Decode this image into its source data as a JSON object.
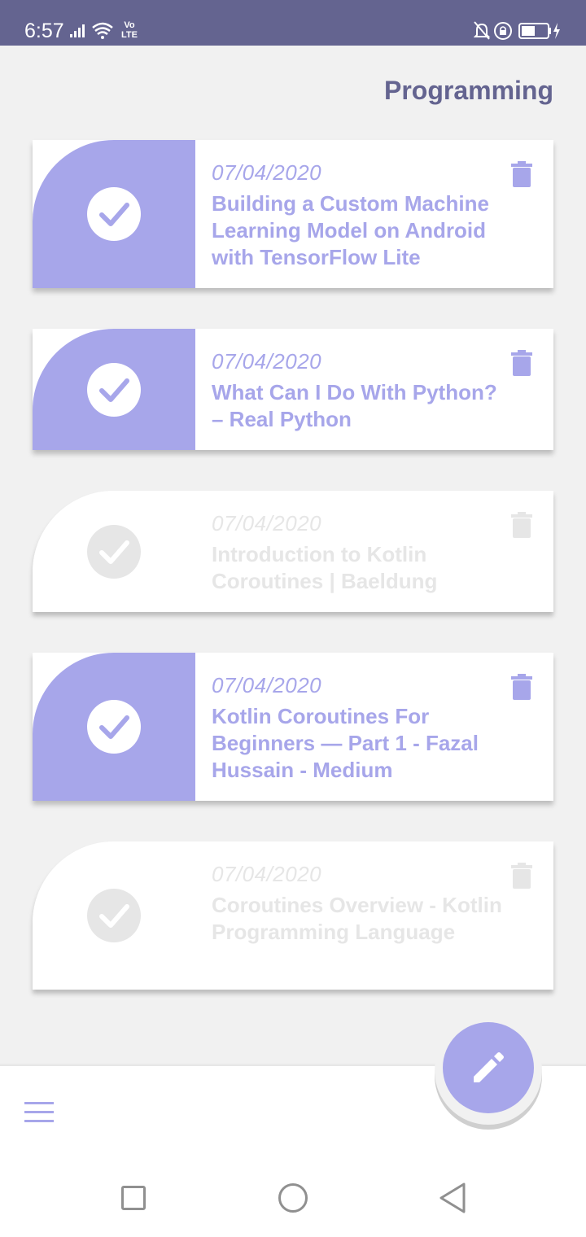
{
  "status_bar": {
    "time": "6:57",
    "volte": "Vo\nLTE",
    "icons": [
      "signal-icon",
      "wifi-icon",
      "volte-icon",
      "mute-bell-icon",
      "lock-rotation-icon",
      "battery-icon"
    ]
  },
  "header": {
    "title": "Programming"
  },
  "cards": [
    {
      "date": "07/04/2020",
      "title": "Building a Custom Machine Learning Model on Android with TensorFlow Lite",
      "done": true
    },
    {
      "date": "07/04/2020",
      "title": "What Can I Do With Python? – Real Python",
      "done": true
    },
    {
      "date": "07/04/2020",
      "title": "Introduction to Kotlin Coroutines | Baeldung",
      "done": false
    },
    {
      "date": "07/04/2020",
      "title": "Kotlin Coroutines For Beginners — Part 1 - Fazal Hussain - Medium",
      "done": true
    },
    {
      "date": "07/04/2020",
      "title": "Coroutines Overview - Kotlin Programming Language",
      "done": false
    }
  ],
  "bottom_bar": {
    "menu_icon": "hamburger-menu-icon",
    "fab_icon": "pencil-icon"
  },
  "nav_bar": {
    "icons": [
      "recents-icon",
      "home-icon",
      "back-icon"
    ]
  },
  "colors": {
    "accent": "#a7a6ea",
    "status_bar": "#646490",
    "title": "#646490",
    "faded": "#e6e6e6",
    "background": "#f1f1f1"
  }
}
